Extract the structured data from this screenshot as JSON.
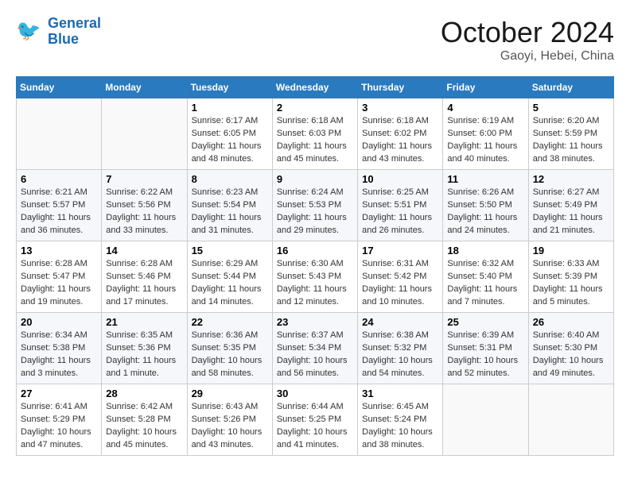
{
  "header": {
    "logo_general": "General",
    "logo_blue": "Blue",
    "month_title": "October 2024",
    "location": "Gaoyi, Hebei, China"
  },
  "weekdays": [
    "Sunday",
    "Monday",
    "Tuesday",
    "Wednesday",
    "Thursday",
    "Friday",
    "Saturday"
  ],
  "weeks": [
    [
      {
        "day": "",
        "sunrise": "",
        "sunset": "",
        "daylight": "",
        "empty": true
      },
      {
        "day": "",
        "sunrise": "",
        "sunset": "",
        "daylight": "",
        "empty": true
      },
      {
        "day": "1",
        "sunrise": "Sunrise: 6:17 AM",
        "sunset": "Sunset: 6:05 PM",
        "daylight": "Daylight: 11 hours and 48 minutes."
      },
      {
        "day": "2",
        "sunrise": "Sunrise: 6:18 AM",
        "sunset": "Sunset: 6:03 PM",
        "daylight": "Daylight: 11 hours and 45 minutes."
      },
      {
        "day": "3",
        "sunrise": "Sunrise: 6:18 AM",
        "sunset": "Sunset: 6:02 PM",
        "daylight": "Daylight: 11 hours and 43 minutes."
      },
      {
        "day": "4",
        "sunrise": "Sunrise: 6:19 AM",
        "sunset": "Sunset: 6:00 PM",
        "daylight": "Daylight: 11 hours and 40 minutes."
      },
      {
        "day": "5",
        "sunrise": "Sunrise: 6:20 AM",
        "sunset": "Sunset: 5:59 PM",
        "daylight": "Daylight: 11 hours and 38 minutes."
      }
    ],
    [
      {
        "day": "6",
        "sunrise": "Sunrise: 6:21 AM",
        "sunset": "Sunset: 5:57 PM",
        "daylight": "Daylight: 11 hours and 36 minutes."
      },
      {
        "day": "7",
        "sunrise": "Sunrise: 6:22 AM",
        "sunset": "Sunset: 5:56 PM",
        "daylight": "Daylight: 11 hours and 33 minutes."
      },
      {
        "day": "8",
        "sunrise": "Sunrise: 6:23 AM",
        "sunset": "Sunset: 5:54 PM",
        "daylight": "Daylight: 11 hours and 31 minutes."
      },
      {
        "day": "9",
        "sunrise": "Sunrise: 6:24 AM",
        "sunset": "Sunset: 5:53 PM",
        "daylight": "Daylight: 11 hours and 29 minutes."
      },
      {
        "day": "10",
        "sunrise": "Sunrise: 6:25 AM",
        "sunset": "Sunset: 5:51 PM",
        "daylight": "Daylight: 11 hours and 26 minutes."
      },
      {
        "day": "11",
        "sunrise": "Sunrise: 6:26 AM",
        "sunset": "Sunset: 5:50 PM",
        "daylight": "Daylight: 11 hours and 24 minutes."
      },
      {
        "day": "12",
        "sunrise": "Sunrise: 6:27 AM",
        "sunset": "Sunset: 5:49 PM",
        "daylight": "Daylight: 11 hours and 21 minutes."
      }
    ],
    [
      {
        "day": "13",
        "sunrise": "Sunrise: 6:28 AM",
        "sunset": "Sunset: 5:47 PM",
        "daylight": "Daylight: 11 hours and 19 minutes."
      },
      {
        "day": "14",
        "sunrise": "Sunrise: 6:28 AM",
        "sunset": "Sunset: 5:46 PM",
        "daylight": "Daylight: 11 hours and 17 minutes."
      },
      {
        "day": "15",
        "sunrise": "Sunrise: 6:29 AM",
        "sunset": "Sunset: 5:44 PM",
        "daylight": "Daylight: 11 hours and 14 minutes."
      },
      {
        "day": "16",
        "sunrise": "Sunrise: 6:30 AM",
        "sunset": "Sunset: 5:43 PM",
        "daylight": "Daylight: 11 hours and 12 minutes."
      },
      {
        "day": "17",
        "sunrise": "Sunrise: 6:31 AM",
        "sunset": "Sunset: 5:42 PM",
        "daylight": "Daylight: 11 hours and 10 minutes."
      },
      {
        "day": "18",
        "sunrise": "Sunrise: 6:32 AM",
        "sunset": "Sunset: 5:40 PM",
        "daylight": "Daylight: 11 hours and 7 minutes."
      },
      {
        "day": "19",
        "sunrise": "Sunrise: 6:33 AM",
        "sunset": "Sunset: 5:39 PM",
        "daylight": "Daylight: 11 hours and 5 minutes."
      }
    ],
    [
      {
        "day": "20",
        "sunrise": "Sunrise: 6:34 AM",
        "sunset": "Sunset: 5:38 PM",
        "daylight": "Daylight: 11 hours and 3 minutes."
      },
      {
        "day": "21",
        "sunrise": "Sunrise: 6:35 AM",
        "sunset": "Sunset: 5:36 PM",
        "daylight": "Daylight: 11 hours and 1 minute."
      },
      {
        "day": "22",
        "sunrise": "Sunrise: 6:36 AM",
        "sunset": "Sunset: 5:35 PM",
        "daylight": "Daylight: 10 hours and 58 minutes."
      },
      {
        "day": "23",
        "sunrise": "Sunrise: 6:37 AM",
        "sunset": "Sunset: 5:34 PM",
        "daylight": "Daylight: 10 hours and 56 minutes."
      },
      {
        "day": "24",
        "sunrise": "Sunrise: 6:38 AM",
        "sunset": "Sunset: 5:32 PM",
        "daylight": "Daylight: 10 hours and 54 minutes."
      },
      {
        "day": "25",
        "sunrise": "Sunrise: 6:39 AM",
        "sunset": "Sunset: 5:31 PM",
        "daylight": "Daylight: 10 hours and 52 minutes."
      },
      {
        "day": "26",
        "sunrise": "Sunrise: 6:40 AM",
        "sunset": "Sunset: 5:30 PM",
        "daylight": "Daylight: 10 hours and 49 minutes."
      }
    ],
    [
      {
        "day": "27",
        "sunrise": "Sunrise: 6:41 AM",
        "sunset": "Sunset: 5:29 PM",
        "daylight": "Daylight: 10 hours and 47 minutes."
      },
      {
        "day": "28",
        "sunrise": "Sunrise: 6:42 AM",
        "sunset": "Sunset: 5:28 PM",
        "daylight": "Daylight: 10 hours and 45 minutes."
      },
      {
        "day": "29",
        "sunrise": "Sunrise: 6:43 AM",
        "sunset": "Sunset: 5:26 PM",
        "daylight": "Daylight: 10 hours and 43 minutes."
      },
      {
        "day": "30",
        "sunrise": "Sunrise: 6:44 AM",
        "sunset": "Sunset: 5:25 PM",
        "daylight": "Daylight: 10 hours and 41 minutes."
      },
      {
        "day": "31",
        "sunrise": "Sunrise: 6:45 AM",
        "sunset": "Sunset: 5:24 PM",
        "daylight": "Daylight: 10 hours and 38 minutes."
      },
      {
        "day": "",
        "sunrise": "",
        "sunset": "",
        "daylight": "",
        "empty": true
      },
      {
        "day": "",
        "sunrise": "",
        "sunset": "",
        "daylight": "",
        "empty": true
      }
    ]
  ]
}
